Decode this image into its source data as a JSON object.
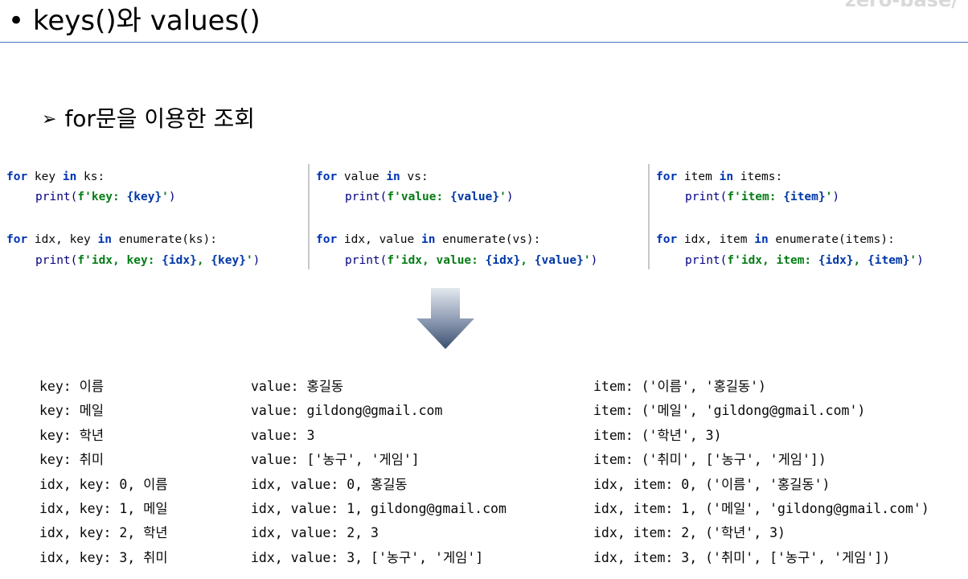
{
  "header": {
    "title": "• keys()와 values()",
    "brand": "zero-base/"
  },
  "section": {
    "bullet": "➢",
    "heading": "for문을 이용한 조회"
  },
  "code_panels": [
    {
      "loop1": {
        "kw_for": "for",
        "var": " key ",
        "kw_in": "in",
        "rest": " ks:"
      },
      "print1": {
        "fn": "print(",
        "str_open": "f'key: ",
        "brace": "{key}",
        "str_close": "'",
        "close": ")"
      },
      "loop2": {
        "kw_for": "for",
        "var": " idx, key ",
        "kw_in": "in",
        "rest": " enumerate(ks):"
      },
      "print2": {
        "fn": "print(",
        "str_open": "f'idx, key: ",
        "brace1": "{idx}",
        "str_mid": ", ",
        "brace2": "{key}",
        "str_close": "'",
        "close": ")"
      }
    },
    {
      "loop1": {
        "kw_for": "for",
        "var": " value ",
        "kw_in": "in",
        "rest": " vs:"
      },
      "print1": {
        "fn": "print(",
        "str_open": "f'value: ",
        "brace": "{value}",
        "str_close": "'",
        "close": ")"
      },
      "loop2": {
        "kw_for": "for",
        "var": " idx, value ",
        "kw_in": "in",
        "rest": " enumerate(vs):"
      },
      "print2": {
        "fn": "print(",
        "str_open": "f'idx, value: ",
        "brace1": "{idx}",
        "str_mid": ", ",
        "brace2": "{value}",
        "str_close": "'",
        "close": ")"
      }
    },
    {
      "loop1": {
        "kw_for": "for",
        "var": " item ",
        "kw_in": "in",
        "rest": " items:"
      },
      "print1": {
        "fn": "print(",
        "str_open": "f'item: ",
        "brace": "{item}",
        "str_close": "'",
        "close": ")"
      },
      "loop2": {
        "kw_for": "for",
        "var": " idx, item ",
        "kw_in": "in",
        "rest": " enumerate(items):"
      },
      "print2": {
        "fn": "print(",
        "str_open": "f'idx, item: ",
        "brace1": "{idx}",
        "str_mid": ", ",
        "brace2": "{item}",
        "str_close": "'",
        "close": ")"
      }
    }
  ],
  "outputs": [
    [
      "key: 이름",
      "key: 메일",
      "key: 학년",
      "key: 취미",
      "idx, key: 0, 이름",
      "idx, key: 1, 메일",
      "idx, key: 2, 학년",
      "idx, key: 3, 취미"
    ],
    [
      "value: 홍길동",
      "value: gildong@gmail.com",
      "value: 3",
      "value: ['농구', '게임']",
      "idx, value: 0, 홍길동",
      "idx, value: 1, gildong@gmail.com",
      "idx, value: 2, 3",
      "idx, value: 3, ['농구', '게임']"
    ],
    [
      "item: ('이름', '홍길동')",
      "item: ('메일', 'gildong@gmail.com')",
      "item: ('학년', 3)",
      "item: ('취미', ['농구', '게임'])",
      "idx, item: 0, ('이름', '홍길동')",
      "idx, item: 1, ('메일', 'gildong@gmail.com')",
      "idx, item: 2, ('학년', 3)",
      "idx, item: 3, ('취미', ['농구', '게임'])"
    ]
  ],
  "colors": {
    "keyword": "#0033b3",
    "string": "#067d17",
    "rule": "#4472c4",
    "arrow_top": "#d6dce6",
    "arrow_bottom": "#3b4f6e"
  },
  "icons": {
    "arrow": "down-arrow-icon"
  }
}
